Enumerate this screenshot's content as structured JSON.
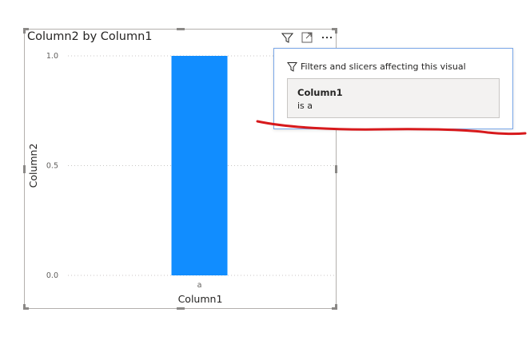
{
  "visual": {
    "title": "Column2 by Column1",
    "header_icons": [
      "filter-icon",
      "focus-mode-icon",
      "more-options-icon"
    ]
  },
  "chart_data": {
    "type": "bar",
    "categories": [
      "a"
    ],
    "values": [
      1.0
    ],
    "xlabel": "Column1",
    "ylabel": "Column2",
    "ylim": [
      0,
      1
    ],
    "yticks": [
      "0.0",
      "0.5",
      "1.0"
    ],
    "grid": true,
    "bar_color": "#118DFF"
  },
  "tooltip": {
    "header": "Filters and slicers affecting this visual",
    "filters": [
      {
        "field": "Column1",
        "condition": "is a"
      }
    ]
  },
  "annotation": {
    "color": "#d7191c"
  }
}
